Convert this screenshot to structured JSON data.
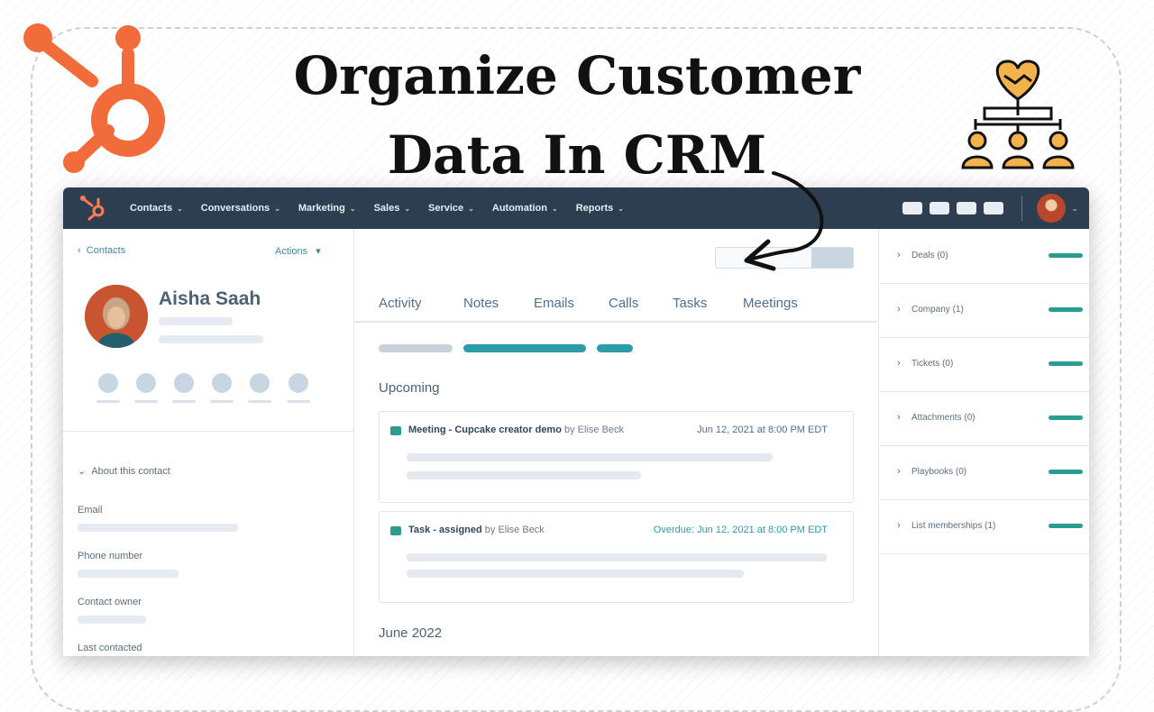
{
  "headline": {
    "line1": "Organize Customer",
    "line2": "Data In CRM"
  },
  "icons": {
    "brand": "hubspot-sprocket-icon",
    "crm": "handshake-team-icon"
  },
  "colors": {
    "brand_orange": "#ff7a59",
    "nav_bg": "#2d3e50",
    "accent_teal": "#2a9d8f"
  },
  "nav": {
    "items": [
      "Contacts",
      "Conversations",
      "Marketing",
      "Sales",
      "Service",
      "Automation",
      "Reports"
    ]
  },
  "contact": {
    "back_label": "Contacts",
    "actions_label": "Actions",
    "name": "Aisha Saah",
    "about_label": "About this contact",
    "fields": [
      "Email",
      "Phone number",
      "Contact owner",
      "Last contacted"
    ]
  },
  "tabs": [
    "Activity",
    "Notes",
    "Emails",
    "Calls",
    "Tasks",
    "Meetings"
  ],
  "timeline": {
    "upcoming_label": "Upcoming",
    "items": [
      {
        "type": "Meeting",
        "title": "Meeting - Cupcake creator demo",
        "by": "by Elise Beck",
        "date": "Jun 12, 2021 at 8:00 PM EDT"
      },
      {
        "type": "Task",
        "title": "Task - assigned",
        "by": "by Elise Beck",
        "date": "Overdue: Jun 12, 2021 at 8:00 PM EDT"
      }
    ],
    "month_label": "June 2022"
  },
  "sidebar": {
    "items": [
      "Deals (0)",
      "Company (1)",
      "Tickets (0)",
      "Attachments (0)",
      "Playbooks (0)",
      "List memberships (1)"
    ]
  }
}
